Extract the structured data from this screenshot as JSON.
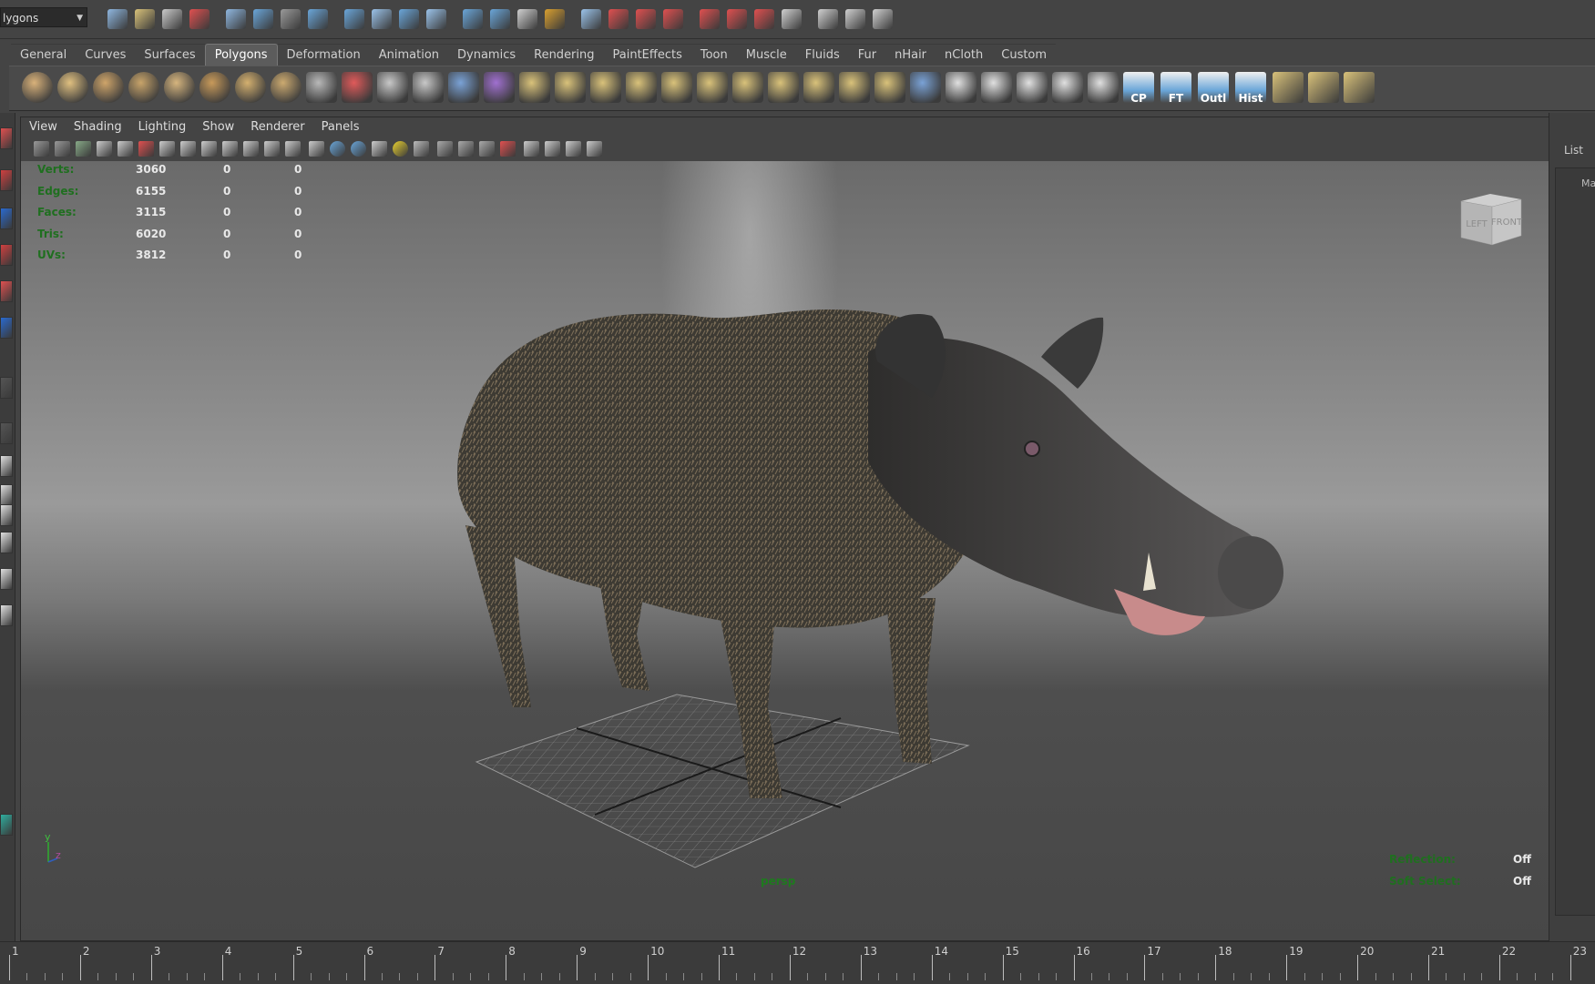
{
  "status_line": {
    "mode": "lygons"
  },
  "shelf_tabs": [
    "General",
    "Curves",
    "Surfaces",
    "Polygons",
    "Deformation",
    "Animation",
    "Dynamics",
    "Rendering",
    "PaintEffects",
    "Toon",
    "Muscle",
    "Fluids",
    "Fur",
    "nHair",
    "nCloth",
    "Custom"
  ],
  "active_shelf_tab": "Polygons",
  "shelf_icons": [
    "poly-sphere-icon",
    "poly-cube-icon",
    "poly-cylinder-icon",
    "poly-cone-icon",
    "poly-plane-icon",
    "poly-torus-icon",
    "poly-pyramid-icon",
    "poly-pipe-icon",
    "combine-icon",
    "separate-icon",
    "mirror-icon",
    "smooth-icon",
    "average-icon",
    "bool-union-icon",
    "extrude-icon",
    "bridge-icon",
    "append-icon",
    "fill-hole-icon",
    "split-icon",
    "insert-edgeloop-icon",
    "offset-edgeloop-icon",
    "wedge-icon",
    "bevel-icon",
    "merge-icon",
    "collapse-icon",
    "plane-uv-icon",
    "cylinder-uv-icon",
    "sphere-uv-icon",
    "auto-uv-icon",
    "uv-editor-icon",
    "checker-icon"
  ],
  "shelf_labeled": [
    {
      "label": "CP"
    },
    {
      "label": "FT"
    },
    {
      "label": "Outl"
    },
    {
      "label": "Hist"
    }
  ],
  "panel_menu": [
    "View",
    "Shading",
    "Lighting",
    "Show",
    "Renderer",
    "Panels"
  ],
  "hud_stats": [
    {
      "label": "Verts:",
      "v1": "3060",
      "v2": "0",
      "v3": "0"
    },
    {
      "label": "Edges:",
      "v1": "6155",
      "v2": "0",
      "v3": "0"
    },
    {
      "label": "Faces:",
      "v1": "3115",
      "v2": "0",
      "v3": "0"
    },
    {
      "label": "Tris:",
      "v1": "6020",
      "v2": "0",
      "v3": "0"
    },
    {
      "label": "UVs:",
      "v1": "3812",
      "v2": "0",
      "v3": "0"
    }
  ],
  "viewcube": {
    "left": "LEFT",
    "front": "FRONT"
  },
  "camera_name": "persp",
  "hud_right": [
    {
      "label": "Reflection:",
      "value": "Off"
    },
    {
      "label": "Soft Select:",
      "value": "Off"
    }
  ],
  "axis": {
    "y": "y",
    "z": "z"
  },
  "right_panel": {
    "list_label": "List",
    "ma": "Ma"
  },
  "timeline": [
    "1",
    "2",
    "3",
    "4",
    "5",
    "6",
    "7",
    "8",
    "9",
    "10",
    "11",
    "12",
    "13",
    "14",
    "15",
    "16",
    "17",
    "18",
    "19",
    "20",
    "21",
    "22",
    "23"
  ],
  "colors": {
    "hud_label": "#1f6f1f",
    "background": "#444444",
    "accent": "#5c5c5c"
  }
}
